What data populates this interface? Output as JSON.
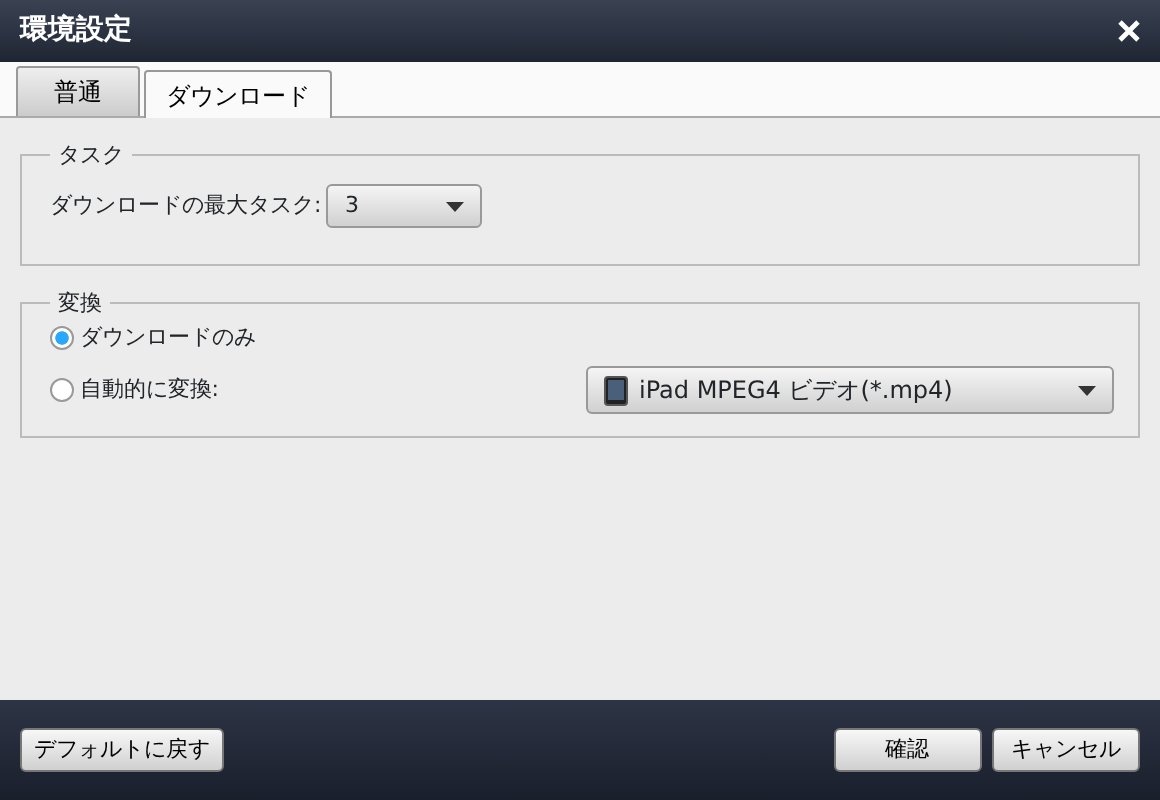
{
  "window": {
    "title": "環境設定"
  },
  "tabs": [
    {
      "label": "普通",
      "selected": false
    },
    {
      "label": "ダウンロード",
      "selected": true
    }
  ],
  "task_group": {
    "title": "タスク",
    "label": "ダウンロードの最大タスク:",
    "value": "3"
  },
  "convert_group": {
    "title": "変換",
    "options": [
      {
        "label": "ダウンロードのみ",
        "selected": true
      },
      {
        "label": "自動的に変換:",
        "selected": false
      }
    ],
    "format_dropdown": {
      "value": "iPad MPEG4 ビデオ(*.mp4)"
    }
  },
  "footer_buttons": {
    "left": [
      "デフォルトに戻す"
    ],
    "right": [
      "確認",
      "キャンセル"
    ]
  }
}
